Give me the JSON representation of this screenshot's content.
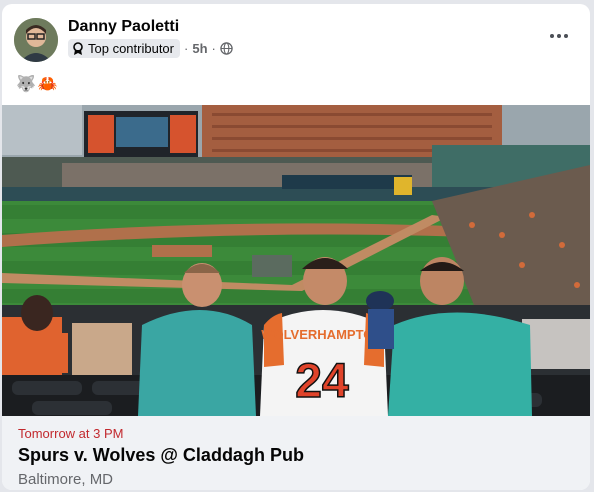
{
  "post": {
    "author": "Danny Paoletti",
    "badge": "Top contributor",
    "time": "5h",
    "audience_icon": "globe-icon",
    "emojis": [
      "🐺",
      "🦀"
    ]
  },
  "photo": {
    "jersey_name": "WOLVERHAMPTON",
    "jersey_number": "24"
  },
  "event": {
    "when": "Tomorrow at 3 PM",
    "title": "Spurs v. Wolves @ Claddagh Pub",
    "location": "Baltimore, MD"
  },
  "colors": {
    "accent_red": "#c2292e",
    "grass": "#3c8a3a"
  }
}
